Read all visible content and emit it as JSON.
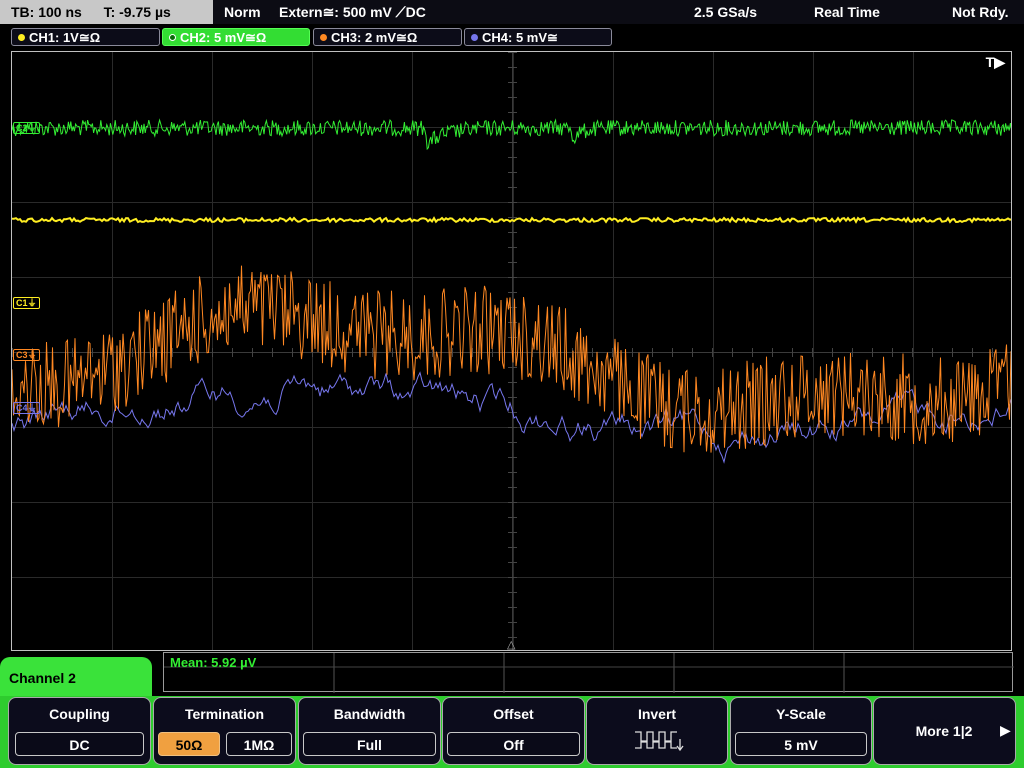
{
  "status": {
    "timebase": "TB: 100 ns",
    "trigger_time": "T: -9.75 µs",
    "acq_mode": "Norm",
    "trigger": "Extern≅: 500 mV ⟋DC",
    "sample_rate": "2.5 GSa/s",
    "realtime": "Real Time",
    "state": "Not Rdy."
  },
  "channels": [
    {
      "label": "CH1: 1V≅Ω",
      "color": "#ffee22"
    },
    {
      "label": "CH2: 5 mV≅Ω",
      "color": "#33ee33"
    },
    {
      "label": "CH3: 2 mV≅Ω",
      "color": "#ff8822"
    },
    {
      "label": "CH4: 5 mV≅",
      "color": "#7777ee"
    }
  ],
  "markers": {
    "trigger": "T▶",
    "c1": "C1⏚",
    "c3": "C3⏚",
    "c4": "C4⏚",
    "c2": "C2⏚"
  },
  "measurement": {
    "mean": "Mean: 5.92 µV"
  },
  "menu": {
    "channel": "Channel 2",
    "coupling": {
      "title": "Coupling",
      "value": "DC"
    },
    "termination": {
      "title": "Termination",
      "options": [
        "50Ω",
        "1MΩ"
      ],
      "selected": "50Ω"
    },
    "bandwidth": {
      "title": "Bandwidth",
      "value": "Full"
    },
    "offset": {
      "title": "Offset",
      "value": "Off"
    },
    "invert": {
      "title": "Invert"
    },
    "yscale": {
      "title": "Y-Scale",
      "value": "5 mV"
    },
    "more": {
      "label": "More 1|2"
    }
  }
}
